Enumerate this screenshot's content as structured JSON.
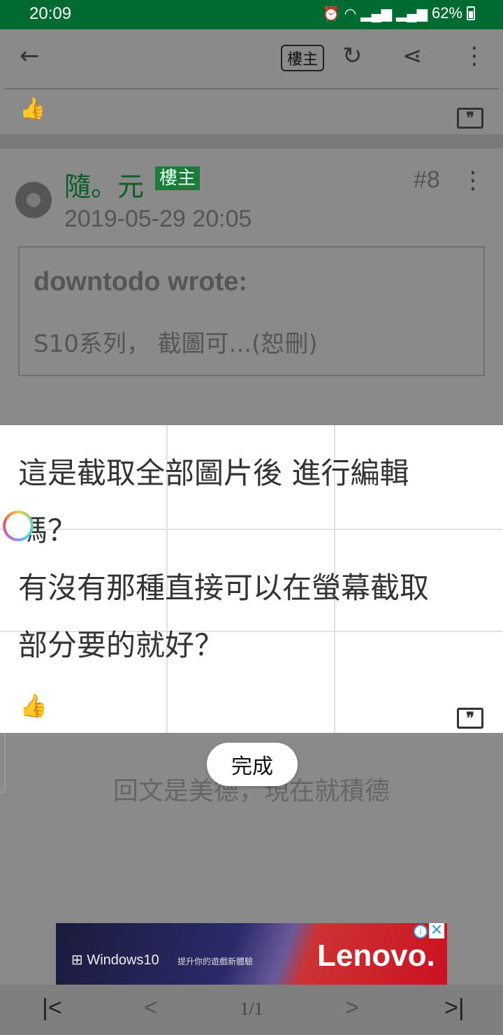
{
  "status_bar": {
    "time": "20:09",
    "battery": "62%"
  },
  "toolbar": {
    "op_badge": "樓主"
  },
  "post": {
    "author": "隨。元",
    "author_badge": "樓主",
    "number": "#8",
    "date": "2019-05-29 20:05",
    "quote_author": "downtodo wrote:",
    "quote_text": "S10系列， 截圖可...(恕刪)",
    "body_lines": [
      "這是截取全部圖片後 進行編輯",
      "嗎？",
      "有沒有那種直接可以在螢幕截取",
      "部分要的就好？"
    ]
  },
  "reply_prompt": "回文是美德，現在就積德",
  "done_label": "完成",
  "ad": {
    "os_text": "Windows10",
    "tagline": "提升你的遊戲新體驗",
    "brand": "Lenovo."
  },
  "pagination": {
    "page": "1/1"
  },
  "colors": {
    "status_bar": "#006b30",
    "accent_green": "#1e7a3a",
    "overlay_gray": "#8a8a8a"
  }
}
